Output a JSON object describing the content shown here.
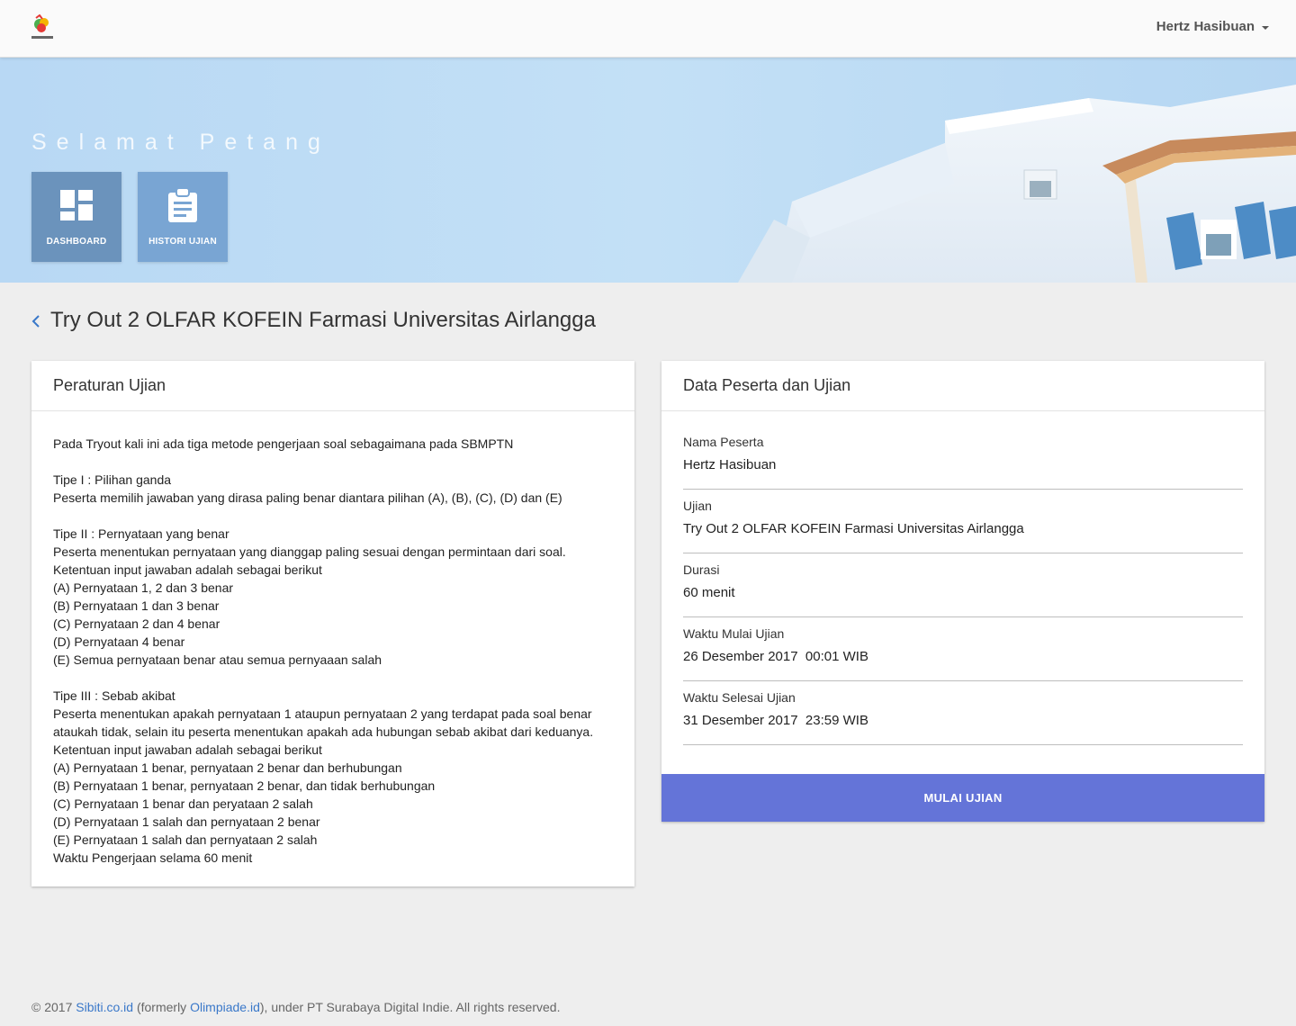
{
  "navbar": {
    "user_name": "Hertz Hasibuan",
    "logo_icon": "brand-logo-icon"
  },
  "hero": {
    "greeting": "Selamat Petang",
    "tiles": [
      {
        "label": "DASHBOARD",
        "icon": "dashboard-icon"
      },
      {
        "label": "HISTORI UJIAN",
        "icon": "clipboard-icon"
      }
    ]
  },
  "page": {
    "title": "Try Out 2 OLFAR KOFEIN Farmasi Universitas Airlangga",
    "back_icon": "chevron-left-icon"
  },
  "rules_card": {
    "title": "Peraturan Ujian",
    "paragraphs": [
      [
        "Pada Tryout kali ini ada tiga metode pengerjaan soal sebagaimana pada SBMPTN"
      ],
      [
        "Tipe I : Pilihan ganda",
        "Peserta memilih jawaban yang dirasa paling benar diantara pilihan (A), (B), (C), (D) dan (E)"
      ],
      [
        "Tipe II : Pernyataan yang benar",
        "Peserta menentukan pernyataan yang dianggap paling sesuai dengan permintaan dari soal.",
        "Ketentuan input jawaban adalah sebagai berikut",
        "(A) Pernyataan 1, 2 dan 3 benar",
        "(B) Pernyataan 1 dan 3 benar",
        "(C) Pernyataan 2 dan 4 benar",
        "(D) Pernyataan 4 benar",
        "(E) Semua pernyataan benar atau semua pernyaaan salah"
      ],
      [
        "Tipe III : Sebab akibat",
        "Peserta menentukan apakah pernyataan 1 ataupun pernyataan 2 yang terdapat pada soal benar",
        "ataukah tidak, selain itu peserta menentukan apakah ada hubungan sebab akibat dari keduanya.",
        "Ketentuan input jawaban adalah sebagai berikut",
        "(A) Pernyataan 1 benar, pernyataan 2 benar dan berhubungan",
        "(B) Pernyataan 1 benar, pernyataan 2 benar, dan tidak berhubungan",
        "(C) Pernyataan 1 benar dan peryataan 2 salah",
        "(D) Pernyataan 1 salah dan pernyataan 2 benar",
        "(E) Pernyataan 1 salah dan pernyataan 2 salah",
        "Waktu Pengerjaan selama 60 menit"
      ]
    ]
  },
  "data_card": {
    "title": "Data Peserta dan Ujian",
    "fields": [
      {
        "label": "Nama Peserta",
        "value": "Hertz Hasibuan"
      },
      {
        "label": "Ujian",
        "value": "Try Out 2 OLFAR KOFEIN Farmasi Universitas Airlangga"
      },
      {
        "label": "Durasi",
        "value": "60 menit"
      },
      {
        "label": "Waktu Mulai Ujian",
        "value": "26 Desember 2017  00:01 WIB"
      },
      {
        "label": "Waktu Selesai Ujian",
        "value": "31 Desember 2017  23:59 WIB"
      }
    ],
    "start_button": "MULAI UJIAN"
  },
  "footer": {
    "prefix": "© 2017 ",
    "link1": "Sibiti.co.id",
    "middle": " (formerly ",
    "link2": "Olimpiade.id",
    "suffix": "), under PT Surabaya Digital Indie. All rights reserved."
  },
  "colors": {
    "accent_button": "#6474d8",
    "link": "#3a78c9",
    "tile_dashboard": "#6b93bc",
    "tile_history": "#79a5d3"
  }
}
